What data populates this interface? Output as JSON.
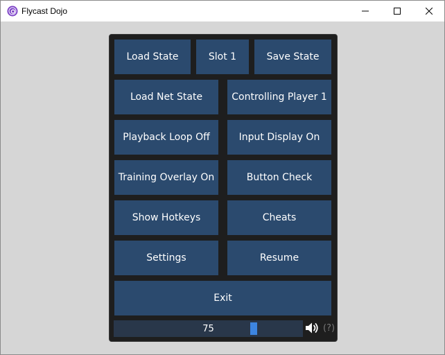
{
  "window": {
    "title": "Flycast Dojo"
  },
  "menu": {
    "load_state": "Load State",
    "slot": "Slot 1",
    "save_state": "Save State",
    "load_net_state": "Load Net State",
    "controlling_player": "Controlling Player 1",
    "playback_loop": "Playback Loop Off",
    "input_display": "Input Display On",
    "training_overlay": "Training Overlay On",
    "button_check": "Button Check",
    "show_hotkeys": "Show Hotkeys",
    "cheats": "Cheats",
    "settings": "Settings",
    "resume": "Resume",
    "exit": "Exit"
  },
  "volume": {
    "value": "75",
    "level": 0.75,
    "help": "(?)"
  },
  "icons": {
    "app": "flycast-swirl-icon",
    "speaker": "speaker-icon"
  },
  "colors": {
    "button": "#2b4a6e",
    "panel": "#1e1e1e",
    "slider_thumb": "#3d85e0",
    "slider_track": "#29374a"
  }
}
